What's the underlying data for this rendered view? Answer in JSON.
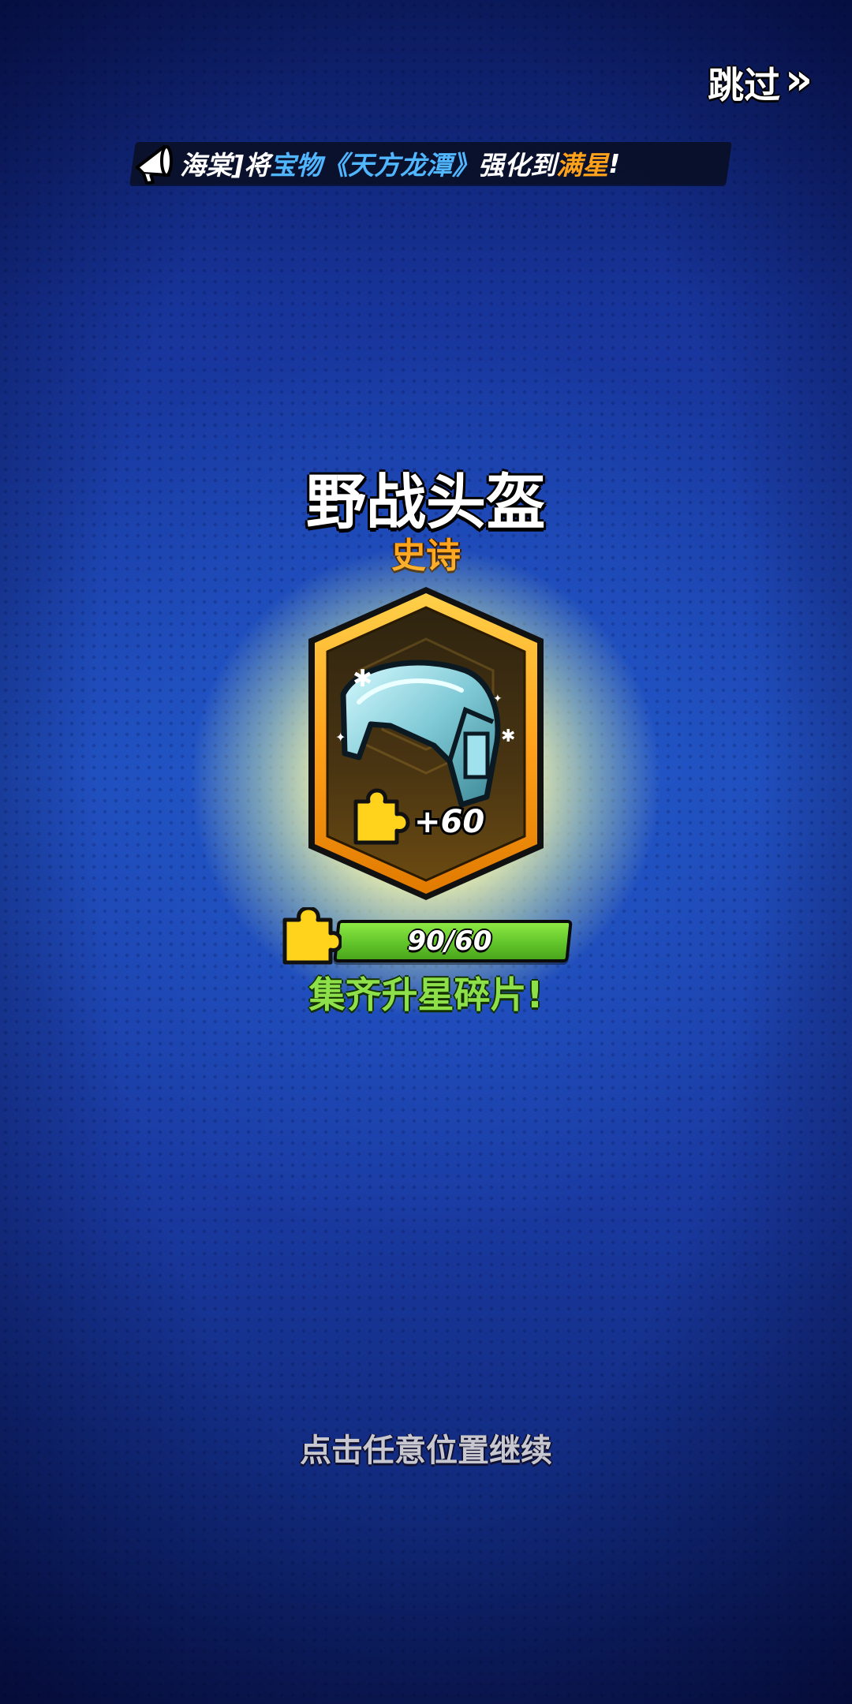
{
  "header": {
    "skip_label": "跳过",
    "skip_icon": "double-chevron-right-icon"
  },
  "ticker": {
    "icon": "megaphone-icon",
    "part1": "海棠]将",
    "part2": "宝物《天方龙潭》",
    "part3": "强化到",
    "part4": "满星",
    "part5": "!",
    "colors": {
      "highlight_blue": "#4fb6ff",
      "highlight_orange": "#ffa21a"
    }
  },
  "item": {
    "name": "野战头盔",
    "rarity": "史诗",
    "rarity_color": "#ffa41c",
    "icon": "field-helmet-icon",
    "fragment_gain": "+60"
  },
  "progress": {
    "text": "90/60",
    "current": 90,
    "required": 60,
    "fraction": 1.0,
    "color": "#62c52a",
    "icon": "puzzle-piece-icon"
  },
  "message": {
    "collect": "集齐升星碎片!",
    "continue": "点击任意位置继续"
  }
}
